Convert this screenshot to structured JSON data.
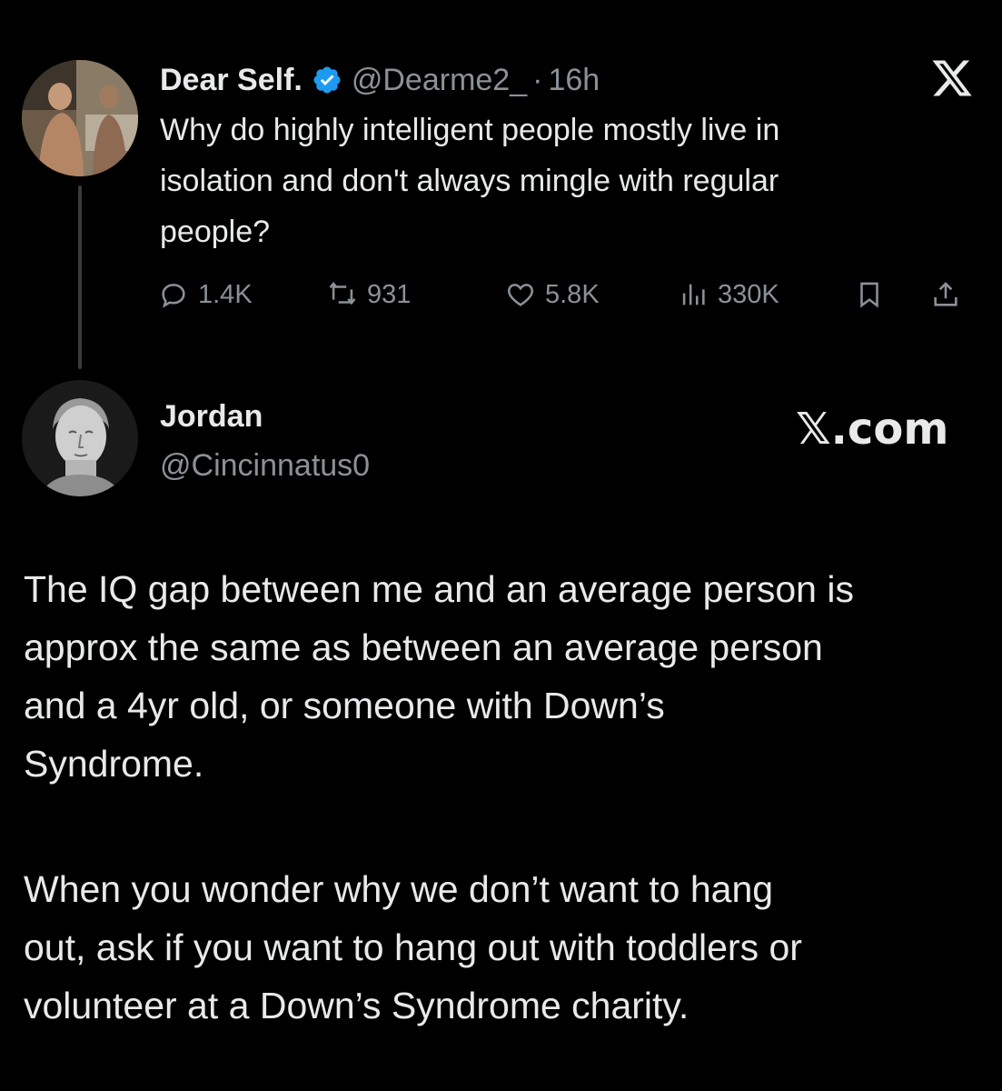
{
  "original_post": {
    "display_name": "Dear Self.",
    "verified": true,
    "handle": "@Dearme2_",
    "separator": "·",
    "time": "16h",
    "text_lines": [
      "Why do highly intelligent people mostly live in",
      "isolation and don't always mingle with regular",
      "people?"
    ],
    "stats": {
      "replies": "1.4K",
      "reposts": "931",
      "likes": "5.8K",
      "views": "330K"
    }
  },
  "reply_post": {
    "display_name": "Jordan",
    "handle": "@Cincinnatus0",
    "source_label": "𝕏.com",
    "paragraph1_lines": [
      "The IQ gap between me and an average person is",
      "approx the same as between an average person",
      "and a 4yr old, or someone with Down’s",
      "Syndrome."
    ],
    "paragraph2_lines": [
      "When you wonder why we don’t want to hang",
      "out, ask if you want to hang out with toddlers or",
      "volunteer at a Down’s Syndrome charity."
    ]
  },
  "colors": {
    "background": "#000000",
    "text": "#e7e9ea",
    "muted": "#8b9197",
    "verified": "#1d9bf0"
  },
  "icons": [
    "verified-badge-icon",
    "x-logo-icon",
    "reply-icon",
    "repost-icon",
    "like-icon",
    "views-icon",
    "bookmark-icon",
    "share-icon"
  ]
}
